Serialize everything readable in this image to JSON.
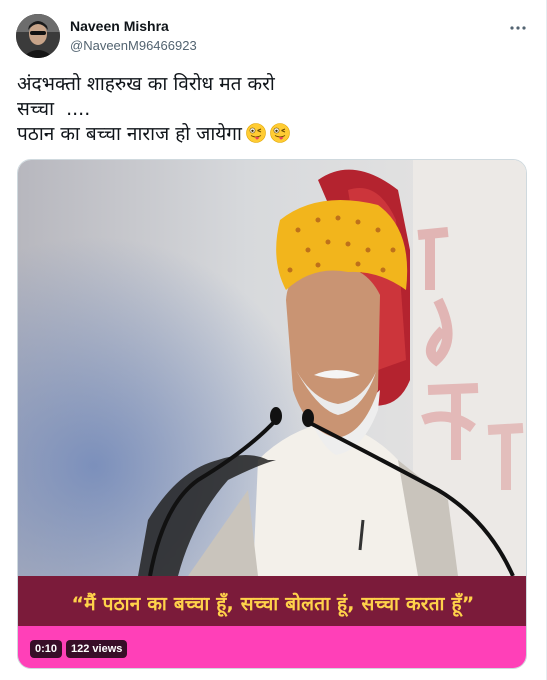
{
  "user": {
    "name": "Naveen Mishra",
    "handle": "@NaveenM96466923"
  },
  "tweet": {
    "lines": [
      "अंदभक्तो शाहरुख का विरोध मत करो",
      "सच्चा  ....",
      "पठान का बच्चा नाराज हो जायेगा"
    ],
    "emoji": [
      "winking-face-with-tongue",
      "winking-face-with-tongue"
    ]
  },
  "media": {
    "caption": "“मैं पठान का बच्चा हूँ, सच्चा बोलता हूं, सच्चा करता हूँ”",
    "duration": "0:10",
    "views": "122 views"
  },
  "colors": {
    "caption_bg": "#7b1b3a",
    "caption_text": "#ffd24a",
    "bottom_bar": "#ff40b8"
  }
}
